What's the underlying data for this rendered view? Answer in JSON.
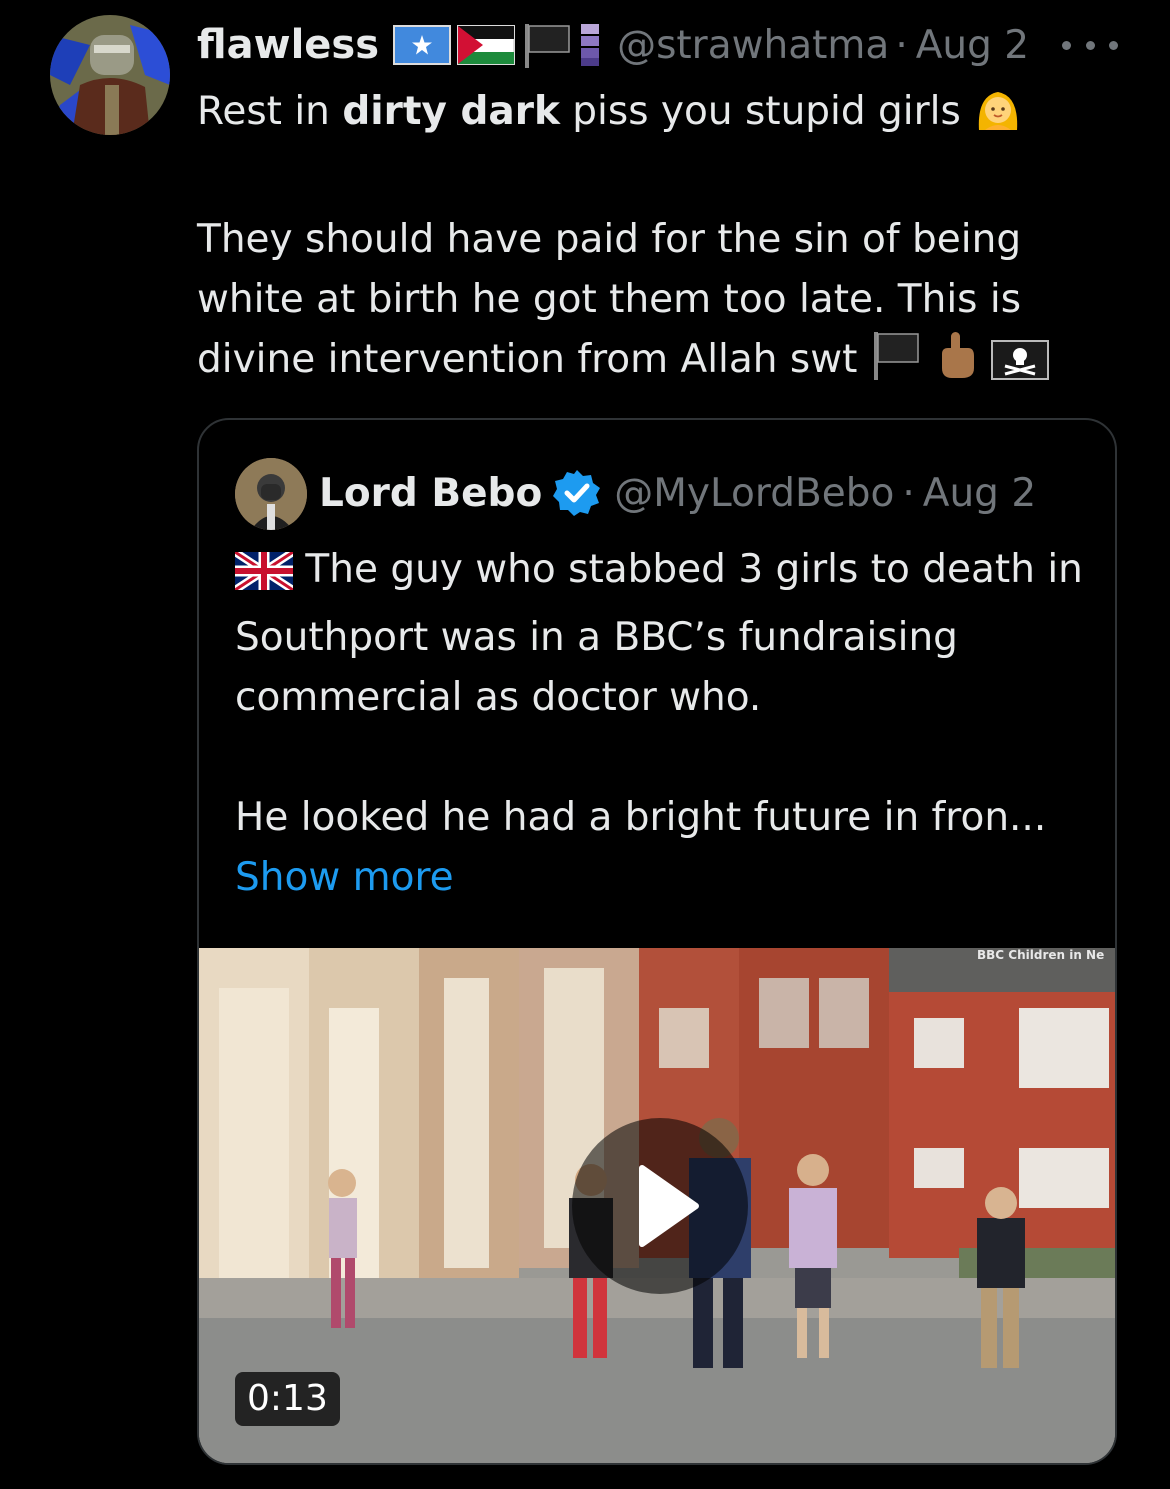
{
  "tweet": {
    "display_name": "flawless",
    "handle": "@strawhatma",
    "separator": "·",
    "timestamp": "Aug 2",
    "text": {
      "line1_start": "Rest in ",
      "line1_bold": "dirty dark",
      "line1_end": " piss you stupid girls",
      "para2": "They should have paid for the sin of being white at birth he got them too late. This is divine intervention from Allah swt"
    },
    "flag_icons": [
      "somalia-flag-icon",
      "palestine-flag-icon",
      "black-flag-icon",
      "purple-flag-icon"
    ],
    "emoji_icons": [
      "person-blond-hair-emoji",
      "black-flag-emoji",
      "index-pointing-up-emoji",
      "pirate-flag-emoji"
    ]
  },
  "quote": {
    "display_name": "Lord Bebo",
    "verified": true,
    "handle": "@MyLordBebo",
    "separator": "·",
    "timestamp": "Aug 2",
    "text_line1": "The guy who stabbed 3 girls to death in Southport was in a BBC’s fundraising commercial as doctor who.",
    "text_line2": "He looked he had a bright future in fron...",
    "show_more": "Show more",
    "video": {
      "watermark": "BBC Children in Ne",
      "duration": "0:13"
    }
  },
  "colors": {
    "background": "#000000",
    "text_primary": "#e7e9ea",
    "text_secondary": "#71767b",
    "link": "#1d9bf0",
    "border": "#2f3336",
    "verified": "#1d9bf0"
  }
}
